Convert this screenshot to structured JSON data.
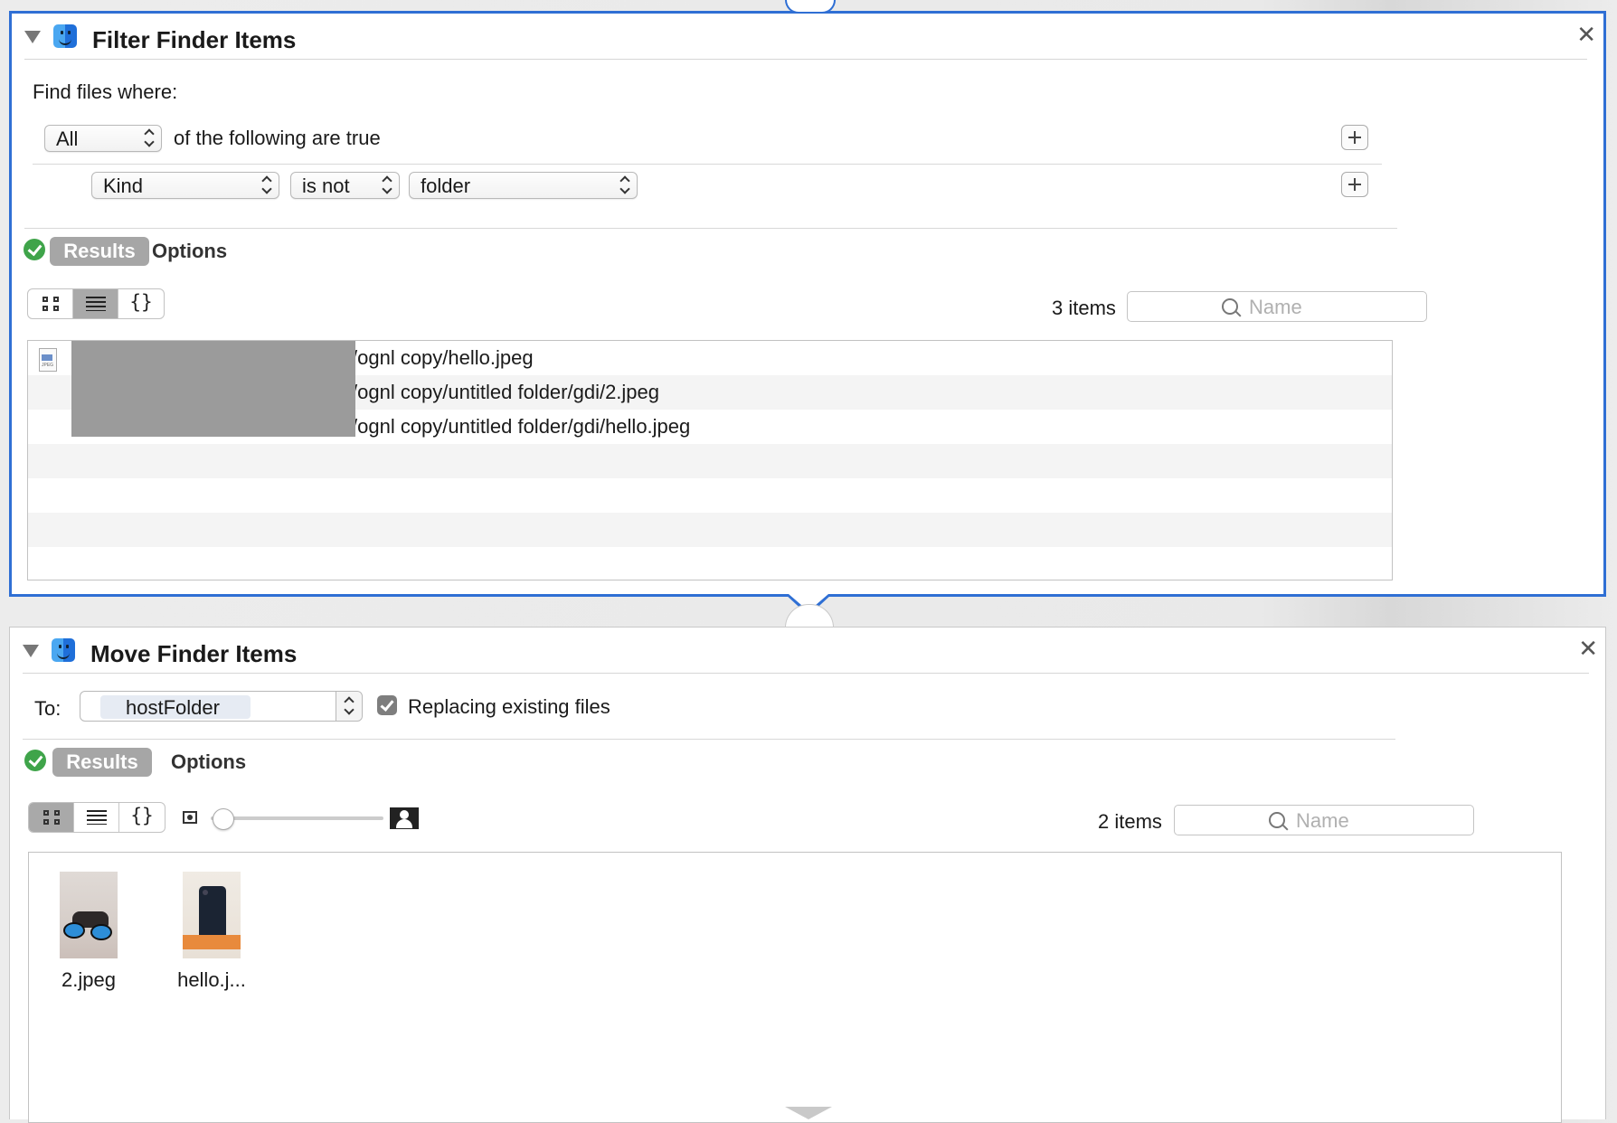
{
  "filter_action": {
    "title": "Filter Finder Items",
    "find_label": "Find files where:",
    "quantifier": "All",
    "quantifier_suffix": "of the following are true",
    "criterion": {
      "attribute": "Kind",
      "operator": "is not",
      "value": "folder"
    },
    "tabs": {
      "results": "Results",
      "options": "Options"
    },
    "item_count": "3 items",
    "search_placeholder": "Name",
    "results": [
      {
        "path": "/ognl copy/hello.jpeg"
      },
      {
        "path": "/ognl copy/untitled folder/gdi/2.jpeg"
      },
      {
        "path": "/ognl copy/untitled folder/gdi/hello.jpeg"
      }
    ]
  },
  "move_action": {
    "title": "Move Finder Items",
    "to_label": "To:",
    "destination": "hostFolder",
    "replace_label": "Replacing existing files",
    "replace_checked": true,
    "tabs": {
      "results": "Results",
      "options": "Options"
    },
    "item_count": "2 items",
    "search_placeholder": "Name",
    "icon_size_level": 0,
    "items": [
      {
        "label": "2.jpeg",
        "thumbnail": "sunglasses-photo"
      },
      {
        "label": "hello.j...",
        "thumbnail": "phone-photo"
      }
    ]
  },
  "colors": {
    "selected_border": "#2f6fd4",
    "success": "#3fa44a"
  }
}
